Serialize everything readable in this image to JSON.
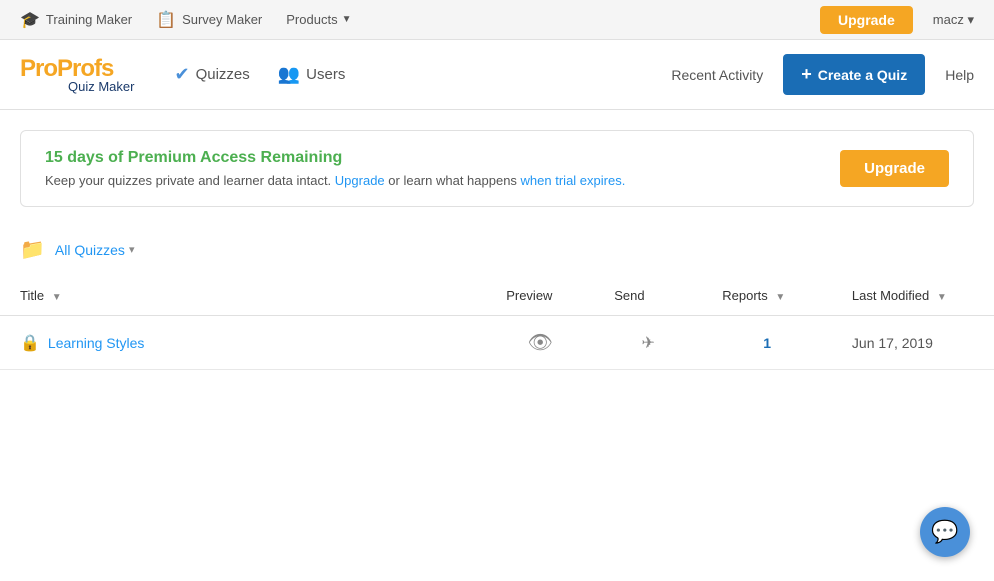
{
  "topNav": {
    "trainingMaker": "Training Maker",
    "surveyMaker": "Survey Maker",
    "products": "Products",
    "productsArrow": "▼",
    "upgradeBtn": "Upgrade",
    "userMenu": "macz",
    "userArrow": "▾"
  },
  "header": {
    "logoTop1": "Pro",
    "logoTop2": "Profs",
    "logoBottom": "Quiz Maker",
    "quizzesLabel": "Quizzes",
    "usersLabel": "Users",
    "recentActivity": "Recent Activity",
    "createQuizBtn": "Create a Quiz",
    "helpLabel": "Help"
  },
  "banner": {
    "title": "15 days of Premium Access Remaining",
    "desc1": "Keep your quizzes private and learner data intact. ",
    "upgradeLink": "Upgrade",
    "desc2": " or learn what happens ",
    "expiresLink": "when trial expires.",
    "upgradeBtn": "Upgrade"
  },
  "quizzesSelector": {
    "label": "All Quizzes",
    "arrow": "▾"
  },
  "table": {
    "cols": {
      "title": "Title",
      "titleArrow": "▼",
      "preview": "Preview",
      "send": "Send",
      "reports": "Reports",
      "reportsArrow": "▼",
      "lastModified": "Last Modified",
      "lastModifiedArrow": "▼"
    },
    "rows": [
      {
        "title": "Learning Styles",
        "preview": "👁",
        "send": "✈",
        "reports": "1",
        "lastModified": "Jun 17, 2019"
      }
    ]
  },
  "chat": {
    "icon": "💬"
  }
}
